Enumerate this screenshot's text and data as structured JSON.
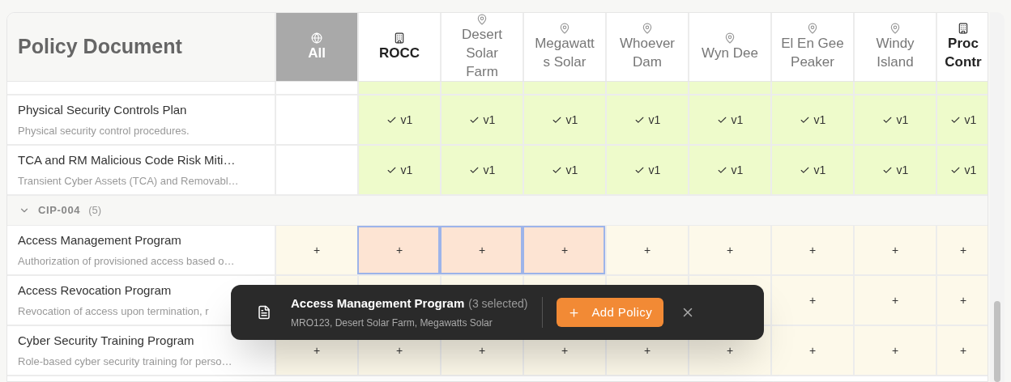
{
  "table": {
    "title": "Policy Document",
    "columns": [
      {
        "label": "All",
        "kind": "all",
        "selected": true
      },
      {
        "label": "ROCC",
        "kind": "building",
        "selected": false
      },
      {
        "label": "Desert Solar Farm",
        "kind": "site",
        "selected": false
      },
      {
        "label": "Megawatts Solar",
        "kind": "site",
        "selected": false
      },
      {
        "label": "Whoever Dam",
        "kind": "site",
        "selected": false
      },
      {
        "label": "Wyn Dee",
        "kind": "site",
        "selected": false
      },
      {
        "label": "El En Gee Peaker",
        "kind": "site",
        "selected": false
      },
      {
        "label": "Windy Island",
        "kind": "site",
        "selected": false
      },
      {
        "label": "Proc Contr",
        "kind": "building",
        "selected": false
      }
    ],
    "sections": [
      {
        "rows": [
          {
            "title": "Physical Security Controls Plan",
            "description": "Physical security control procedures.",
            "cells": [
              {
                "kind": "empty"
              },
              {
                "kind": "done",
                "label": "v1"
              },
              {
                "kind": "done",
                "label": "v1"
              },
              {
                "kind": "done",
                "label": "v1"
              },
              {
                "kind": "done",
                "label": "v1"
              },
              {
                "kind": "done",
                "label": "v1"
              },
              {
                "kind": "done",
                "label": "v1"
              },
              {
                "kind": "done",
                "label": "v1"
              },
              {
                "kind": "done",
                "label": "v1"
              }
            ]
          },
          {
            "title": "TCA and RM Malicious Code Risk Miti…",
            "description": "Transient Cyber Assets (TCA) and Removabl…",
            "cells": [
              {
                "kind": "empty"
              },
              {
                "kind": "done",
                "label": "v1"
              },
              {
                "kind": "done",
                "label": "v1"
              },
              {
                "kind": "done",
                "label": "v1"
              },
              {
                "kind": "done",
                "label": "v1"
              },
              {
                "kind": "done",
                "label": "v1"
              },
              {
                "kind": "done",
                "label": "v1"
              },
              {
                "kind": "done",
                "label": "v1"
              },
              {
                "kind": "done",
                "label": "v1"
              }
            ]
          }
        ]
      },
      {
        "name": "CIP-004",
        "count": "(5)",
        "expanded": true,
        "rows": [
          {
            "title": "Access Management Program",
            "description": "Authorization of provisioned access based o…",
            "cells": [
              {
                "kind": "add",
                "label": "+",
                "selected": false
              },
              {
                "kind": "add",
                "label": "+",
                "selected": true
              },
              {
                "kind": "add",
                "label": "+",
                "selected": true
              },
              {
                "kind": "add",
                "label": "+",
                "selected": true
              },
              {
                "kind": "add",
                "label": "+",
                "selected": false
              },
              {
                "kind": "add",
                "label": "+",
                "selected": false
              },
              {
                "kind": "add",
                "label": "+",
                "selected": false
              },
              {
                "kind": "add",
                "label": "+",
                "selected": false
              },
              {
                "kind": "add",
                "label": "+",
                "selected": false
              }
            ]
          },
          {
            "title": "Access Revocation Program",
            "description": "Revocation of access upon termination, r",
            "cells": [
              {
                "kind": "add",
                "selected": false
              },
              {
                "kind": "add",
                "selected": false
              },
              {
                "kind": "add",
                "selected": false
              },
              {
                "kind": "add",
                "selected": false
              },
              {
                "kind": "add",
                "selected": false
              },
              {
                "kind": "add",
                "selected": false
              },
              {
                "kind": "add",
                "label": "+",
                "selected": false
              },
              {
                "kind": "add",
                "label": "+",
                "selected": false
              },
              {
                "kind": "add",
                "label": "+",
                "selected": false
              }
            ]
          },
          {
            "title": "Cyber Security Training Program",
            "description": "Role-based cyber security training for perso…",
            "cells": [
              {
                "kind": "add",
                "label": "+",
                "selected": false
              },
              {
                "kind": "add",
                "label": "+",
                "selected": false
              },
              {
                "kind": "add",
                "label": "+",
                "selected": false
              },
              {
                "kind": "add",
                "label": "+",
                "selected": false
              },
              {
                "kind": "add",
                "label": "+",
                "selected": false
              },
              {
                "kind": "add",
                "label": "+",
                "selected": false
              },
              {
                "kind": "add",
                "label": "+",
                "selected": false
              },
              {
                "kind": "add",
                "label": "+",
                "selected": false
              },
              {
                "kind": "add",
                "label": "+",
                "selected": false
              }
            ]
          }
        ]
      }
    ]
  },
  "selection_bar": {
    "title": "Access Management Program",
    "count": "(3 selected)",
    "subtitle": "MRO123, Desert Solar Farm, Megawatts Solar",
    "action": "Add Policy"
  }
}
